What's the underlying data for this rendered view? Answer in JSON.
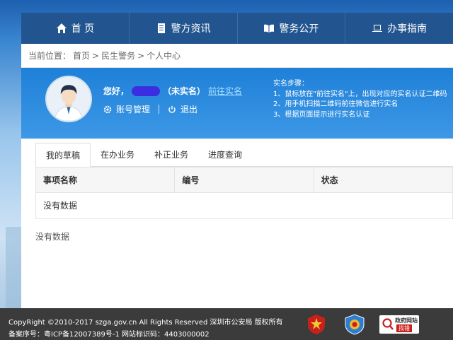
{
  "nav": {
    "items": [
      {
        "label": "首 页",
        "icon": "home-icon"
      },
      {
        "label": "警方资讯",
        "icon": "document-icon"
      },
      {
        "label": "警务公开",
        "icon": "book-icon"
      },
      {
        "label": "办事指南",
        "icon": "laptop-icon"
      }
    ]
  },
  "breadcrumb": {
    "prefix": "当前位置：",
    "items": [
      "首页",
      "民生警务",
      "个人中心"
    ],
    "separator": ">"
  },
  "user": {
    "greeting": "您好，",
    "status": "（未实名）",
    "realname_link": "前往实名",
    "account_label": "账号管理",
    "logout_label": "退出"
  },
  "steps": {
    "title": "实名步骤：",
    "items": [
      "1、鼠标放在\"前往实名\"上，出现对应的实名认证二维码",
      "2、用手机扫描二维码前往微信进行实名",
      "3、根据页面提示进行实名认证"
    ]
  },
  "tabs": [
    "我的草稿",
    "在办业务",
    "补正业务",
    "进度查询"
  ],
  "table": {
    "headers": [
      "事项名称",
      "编号",
      "状态"
    ],
    "empty": "没有数据"
  },
  "empty_text": "没有数据",
  "footer": {
    "copyright": "CopyRight ©2010-2017 szga.gov.cn All Rights Reserved 深圳市公安局 版权所有",
    "icp": "备案序号：粤ICP备12007389号-1 网站标识码：4403000002",
    "badge_text": "找错",
    "badge_top": "政府网站"
  },
  "colors": {
    "nav": "#22558f",
    "userbox": "#2a8ae0",
    "footer": "#3b3b3b"
  }
}
